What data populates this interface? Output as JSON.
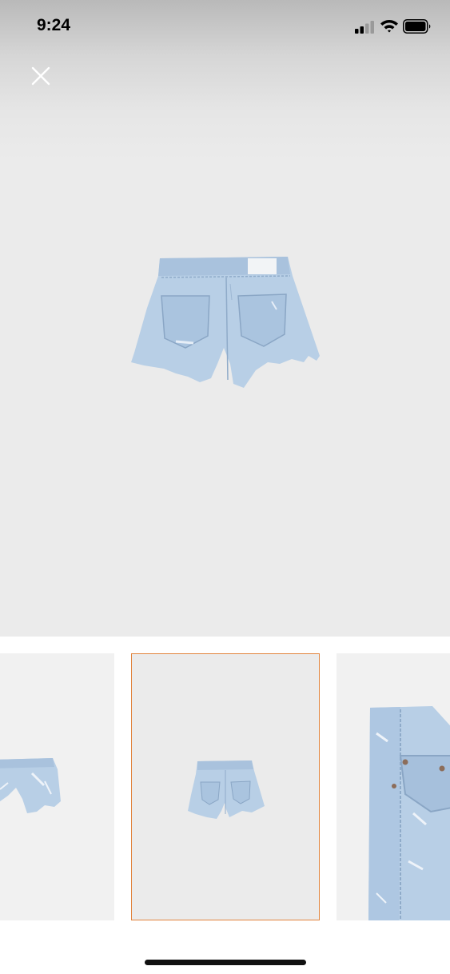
{
  "status_bar": {
    "time": "9:24"
  },
  "icons": {
    "close": "close-icon",
    "signal": "cellular-signal-icon",
    "wifi": "wifi-icon",
    "battery": "battery-icon"
  },
  "product": {
    "main_image": "denim-shorts-back-view",
    "thumbnails": [
      {
        "image": "denim-shorts-front-view",
        "selected": false
      },
      {
        "image": "denim-shorts-back-view",
        "selected": true
      },
      {
        "image": "denim-shorts-detail-closeup",
        "selected": false
      }
    ]
  },
  "colors": {
    "selected_border": "#e1833c",
    "denim": "#b8cfe6"
  }
}
